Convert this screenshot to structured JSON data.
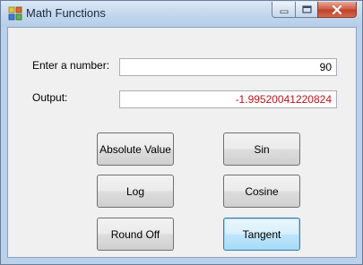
{
  "window": {
    "title": "Math Functions"
  },
  "form": {
    "input_label": "Enter a number:",
    "input_value": "90",
    "output_label": "Output:",
    "output_value": "-1.99520041220824",
    "output_color": "#c0141c"
  },
  "buttons": {
    "absolute": "Absolute Value",
    "sin": "Sin",
    "log": "Log",
    "cosine": "Cosine",
    "round": "Round Off",
    "tangent": "Tangent"
  },
  "icons": {
    "app": "app-icon",
    "minimize": "minimize-icon",
    "maximize": "maximize-icon",
    "close": "close-icon"
  }
}
